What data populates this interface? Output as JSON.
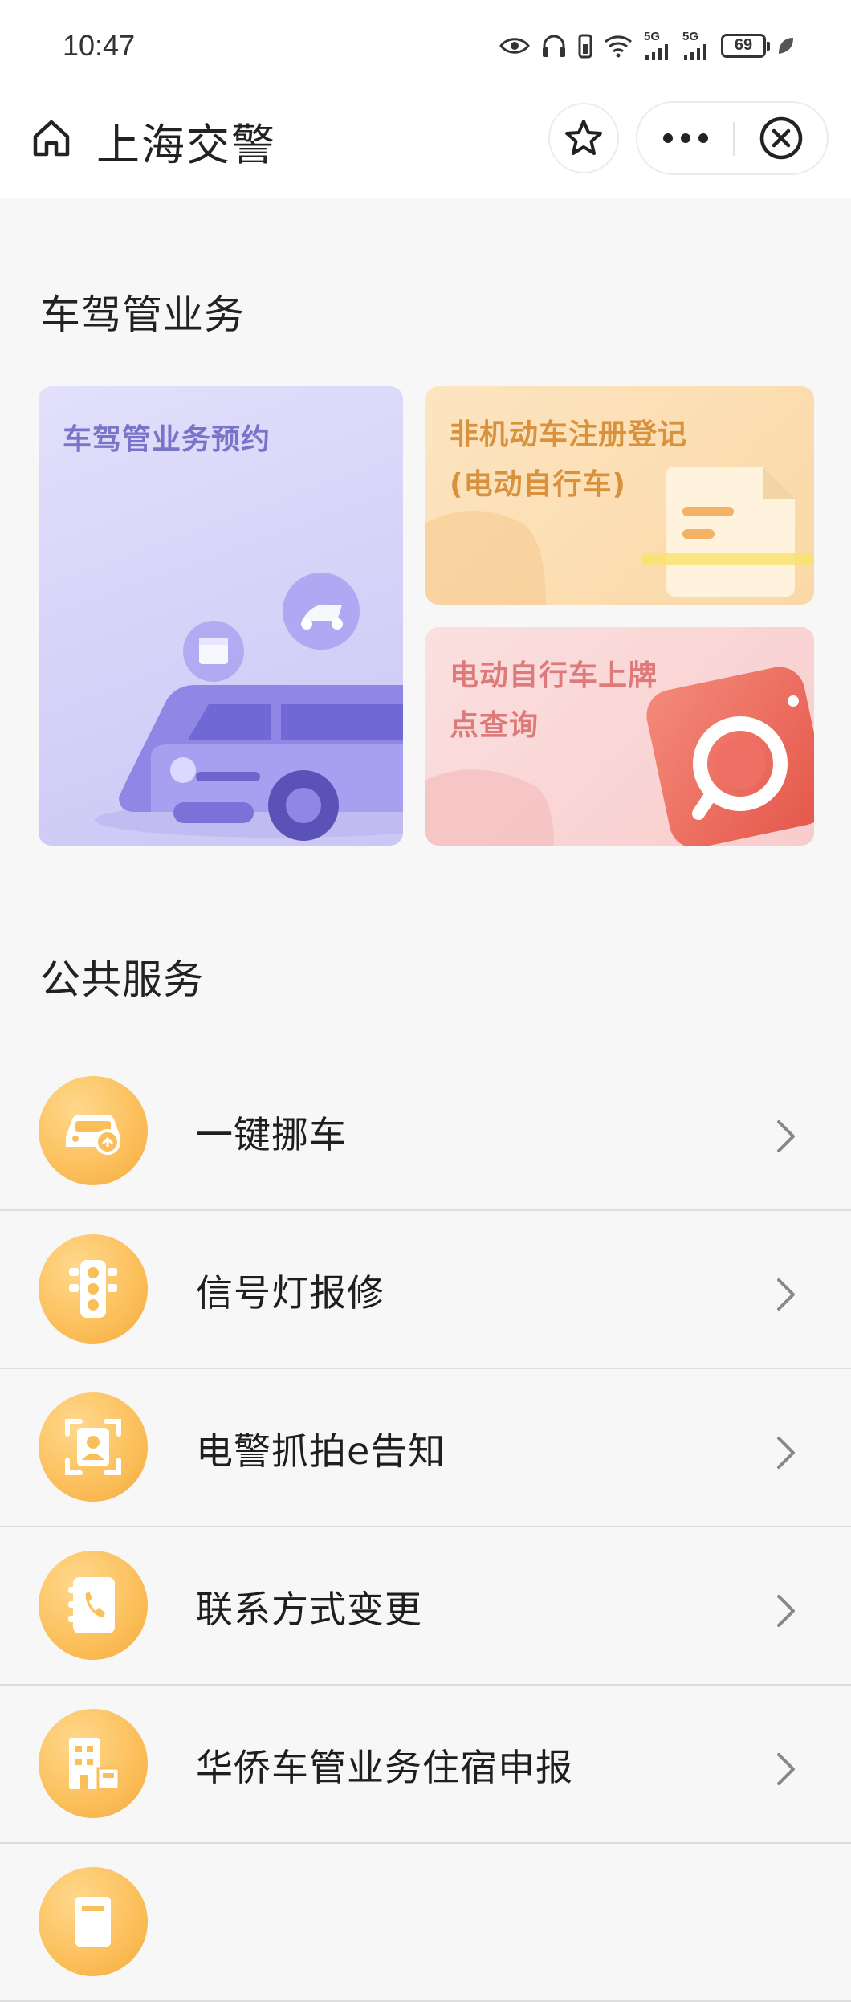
{
  "status_bar": {
    "time": "10:47",
    "network_1": "5G",
    "network_2": "5G",
    "battery": "69"
  },
  "nav": {
    "title": "上海交警"
  },
  "section_vehicle": {
    "title": "车驾管业务",
    "cards": [
      {
        "label": "车驾管业务预约"
      },
      {
        "label_line1": "非机动车注册登记",
        "label_line2": "(电动自行车)"
      },
      {
        "label_line1": "电动自行车上牌",
        "label_line2": "点查询"
      }
    ]
  },
  "section_public": {
    "title": "公共服务",
    "items": [
      {
        "label": "一键挪车",
        "icon": "car-move-icon"
      },
      {
        "label": "信号灯报修",
        "icon": "traffic-light-icon"
      },
      {
        "label": "电警抓拍e告知",
        "icon": "camera-capture-icon"
      },
      {
        "label": "联系方式变更",
        "icon": "phone-book-icon"
      },
      {
        "label": "华侨车管业务住宿申报",
        "icon": "building-icon"
      },
      {
        "label": "",
        "icon": "document-icon"
      }
    ]
  },
  "colors": {
    "accent_orange": "#fbbf5a",
    "card_purple": "#d5d1f8",
    "card_orange": "#fbd8a6",
    "card_pink": "#f8cccc"
  }
}
